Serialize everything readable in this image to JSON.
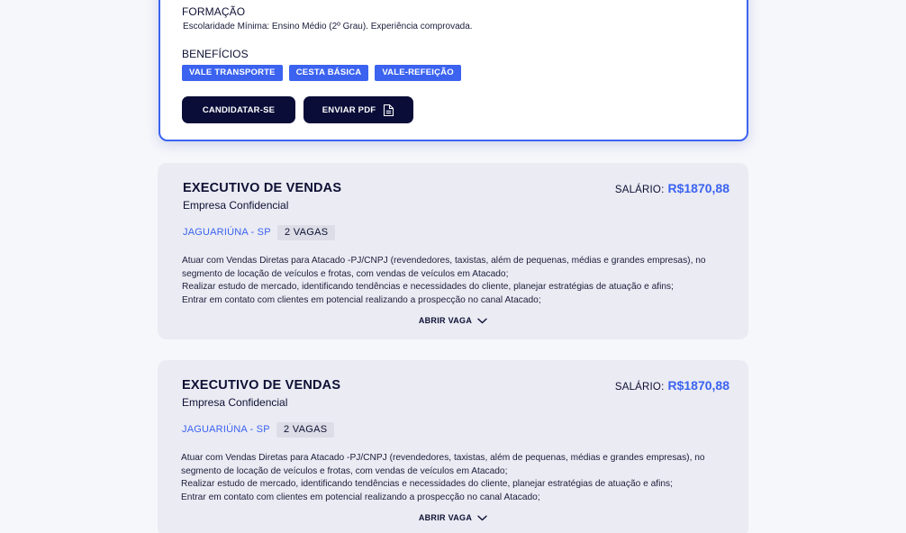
{
  "expanded_job": {
    "education_title": "FORMAÇÃO",
    "education_text": "Escolaridade Mínima: Ensino Médio (2º Grau). Experiência comprovada.",
    "benefits_title": "BENEFÍCIOS",
    "benefits": [
      "VALE TRANSPORTE",
      "CESTA BÁSICA",
      "VALE-REFEIÇÃO"
    ],
    "apply_label": "CANDIDATAR-SE",
    "send_pdf_label": "ENVIAR PDF"
  },
  "jobs": [
    {
      "title": "EXECUTIVO DE VENDAS",
      "company": "Empresa Confidencial",
      "salary_label": "SALÁRIO:",
      "salary_value": "R$1870,88",
      "location": "JAGUARIÚNA - SP",
      "vacancies": "2 VAGAS",
      "description": [
        "Atuar com Vendas Diretas para Atacado -PJ/CNPJ (revendedores, taxistas, além de pequenas, médias e grandes empresas), no segmento de locação de veículos e frotas, com vendas de veículos em Atacado;",
        "Realizar estudo de mercado, identificando tendências e necessidades do cliente, planejar estratégias de atuação e afins;",
        "Entrar em contato com clientes em potencial realizando a prospecção no canal Atacado;"
      ],
      "open_label": "ABRIR VAGA"
    },
    {
      "title": "EXECUTIVO DE VENDAS",
      "company": "Empresa Confidencial",
      "salary_label": "SALÁRIO:",
      "salary_value": "R$1870,88",
      "location": "JAGUARIÚNA - SP",
      "vacancies": "2 VAGAS",
      "description": [
        "Atuar com Vendas Diretas para Atacado -PJ/CNPJ (revendedores, taxistas, além de pequenas, médias e grandes empresas), no segmento de locação de veículos e frotas, com vendas de veículos em Atacado;",
        "Realizar estudo de mercado, identificando tendências e necessidades do cliente, planejar estratégias de atuação e afins;",
        "Entrar em contato com clientes em potencial realizando a prospecção no canal Atacado;"
      ],
      "open_label": "ABRIR VAGA"
    }
  ],
  "colors": {
    "accent": "#3b63f0",
    "dark_button": "#0a0d38",
    "card_bg": "#eaebf3",
    "page_bg": "#f6f7fb"
  }
}
